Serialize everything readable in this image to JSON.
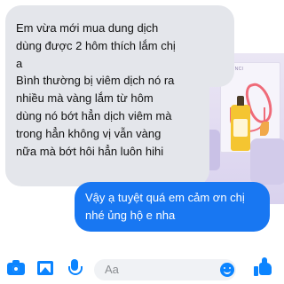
{
  "messages": {
    "incoming_1": "Em vừa mới mua dung dịch\ndùng được 2 hôm thích lắm chị\nạ",
    "incoming_2": "Bình thường bị viêm dịch nó ra\nnhiều mà vàng lắm từ hôm\ndùng nó bớt hẳn dịch viêm mà\ntrong hẳn không vị vẫn vàng\nnữa mà bớt hôi hẳn luôn hihi",
    "outgoing_1": "Vậy ạ tuyệt quá em cảm ơn chị\nnhé ủng hộ e nha"
  },
  "photo": {
    "brand_text": "LAVINCI"
  },
  "composer": {
    "placeholder": "Aa",
    "icons": [
      "camera-icon",
      "image-icon",
      "microphone-icon",
      "emoji-icon",
      "thumbs-up-icon"
    ],
    "accent": "#0b84ff"
  },
  "colors": {
    "incoming_bg": "#e4e6eb",
    "outgoing_bg": "#1877f2"
  }
}
